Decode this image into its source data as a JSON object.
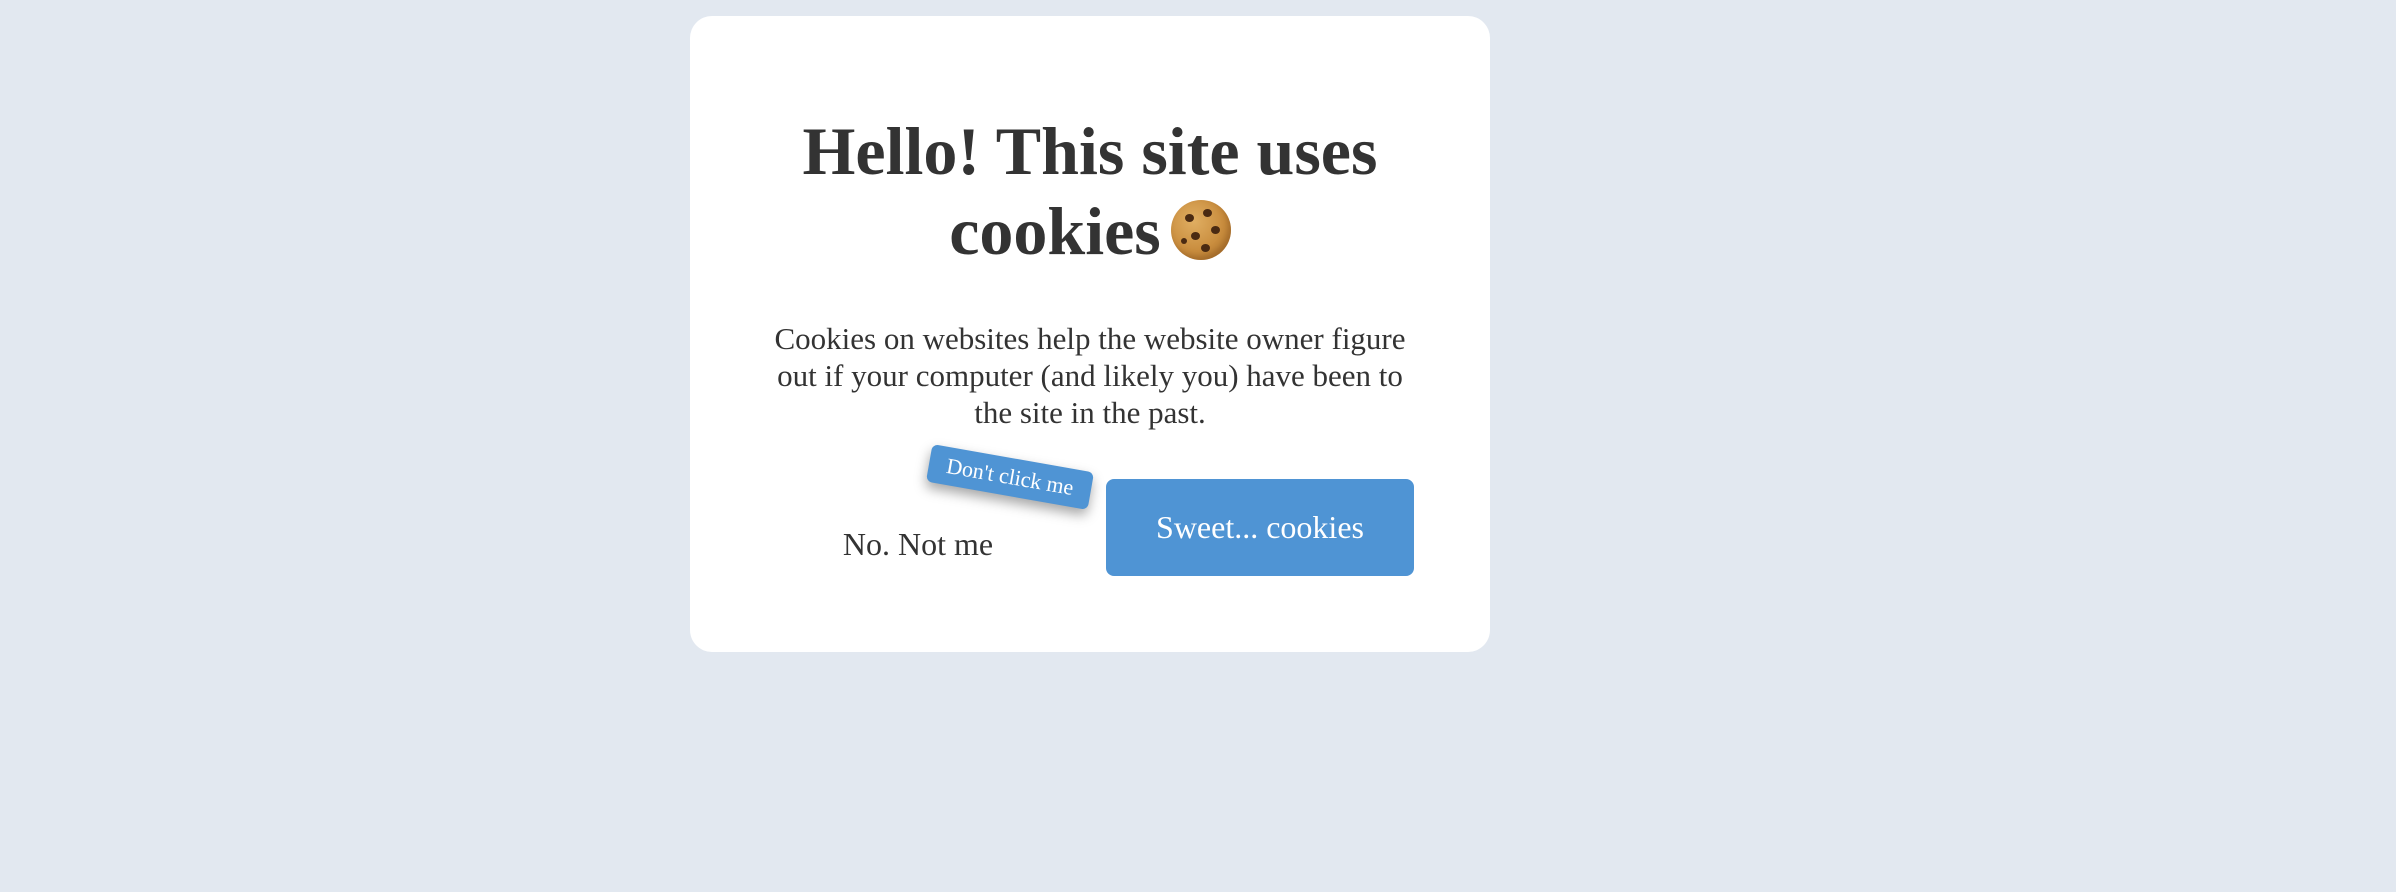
{
  "dialog": {
    "title": "Hello! This site uses cookies",
    "title_line1": "Hello! This site uses",
    "title_line2": "cookies",
    "icon": "cookie-icon",
    "description": "Cookies on websites help the website owner figure out if your computer (and likely you) have been to the site in the past.",
    "decline_label": "No. Not me",
    "decline_tooltip": "Don't click me",
    "accept_label": "Sweet... cookies"
  },
  "colors": {
    "background": "#e2e8f0",
    "card": "#ffffff",
    "text": "#333333",
    "accent": "#4f94d4"
  }
}
